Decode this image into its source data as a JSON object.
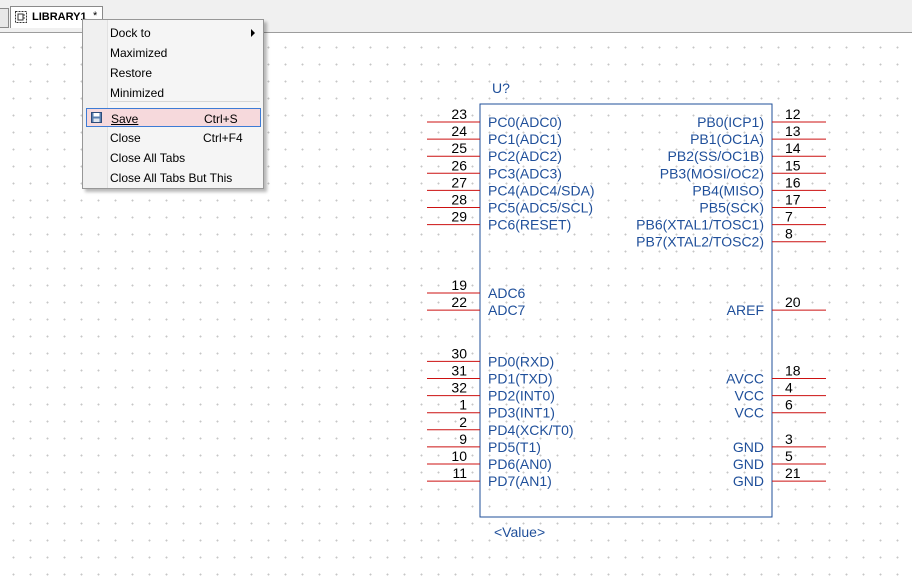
{
  "tab": {
    "title": "LIBRARY1",
    "modified_marker": "*"
  },
  "context_menu": {
    "items": [
      {
        "label": "Dock to",
        "shortcut": "",
        "submenu": true
      },
      {
        "label": "Maximized",
        "shortcut": ""
      },
      {
        "label": "Restore",
        "shortcut": ""
      },
      {
        "label": "Minimized",
        "shortcut": ""
      },
      {
        "label": "Save",
        "shortcut": "Ctrl+S",
        "highlighted": true
      },
      {
        "label": "Close",
        "shortcut": "Ctrl+F4"
      },
      {
        "label": "Close All Tabs",
        "shortcut": ""
      },
      {
        "label": "Close All Tabs But This",
        "shortcut": ""
      }
    ]
  },
  "symbol": {
    "reference": "U?",
    "value": "<Value>",
    "colors": {
      "pin": "#cc1111",
      "body": "#1f4f9a",
      "text": "#1f4f9a",
      "pin_number": "#000000"
    },
    "left_pins": [
      {
        "number": "23",
        "name": "PC0(ADC0)"
      },
      {
        "number": "24",
        "name": "PC1(ADC1)"
      },
      {
        "number": "25",
        "name": "PC2(ADC2)"
      },
      {
        "number": "26",
        "name": "PC3(ADC3)"
      },
      {
        "number": "27",
        "name": "PC4(ADC4/SDA)"
      },
      {
        "number": "28",
        "name": "PC5(ADC5/SCL)"
      },
      {
        "number": "29",
        "name": "PC6(RESET)"
      },
      {
        "number": "19",
        "name": "ADC6"
      },
      {
        "number": "22",
        "name": "ADC7"
      },
      {
        "number": "30",
        "name": "PD0(RXD)"
      },
      {
        "number": "31",
        "name": "PD1(TXD)"
      },
      {
        "number": "32",
        "name": "PD2(INT0)"
      },
      {
        "number": "1",
        "name": "PD3(INT1)"
      },
      {
        "number": "2",
        "name": "PD4(XCK/T0)"
      },
      {
        "number": "9",
        "name": "PD5(T1)"
      },
      {
        "number": "10",
        "name": "PD6(AN0)"
      },
      {
        "number": "11",
        "name": "PD7(AN1)"
      }
    ],
    "right_pins": [
      {
        "number": "12",
        "name": "PB0(ICP1)"
      },
      {
        "number": "13",
        "name": "PB1(OC1A)"
      },
      {
        "number": "14",
        "name": "PB2(SS/OC1B)"
      },
      {
        "number": "15",
        "name": "PB3(MOSI/OC2)"
      },
      {
        "number": "16",
        "name": "PB4(MISO)"
      },
      {
        "number": "17",
        "name": "PB5(SCK)"
      },
      {
        "number": "7",
        "name": "PB6(XTAL1/TOSC1)"
      },
      {
        "number": "8",
        "name": "PB7(XTAL2/TOSC2)"
      },
      {
        "number": "20",
        "name": "AREF"
      },
      {
        "number": "18",
        "name": "AVCC"
      },
      {
        "number": "4",
        "name": "VCC"
      },
      {
        "number": "6",
        "name": "VCC"
      },
      {
        "number": "3",
        "name": "GND"
      },
      {
        "number": "5",
        "name": "GND"
      },
      {
        "number": "21",
        "name": "GND"
      }
    ]
  }
}
